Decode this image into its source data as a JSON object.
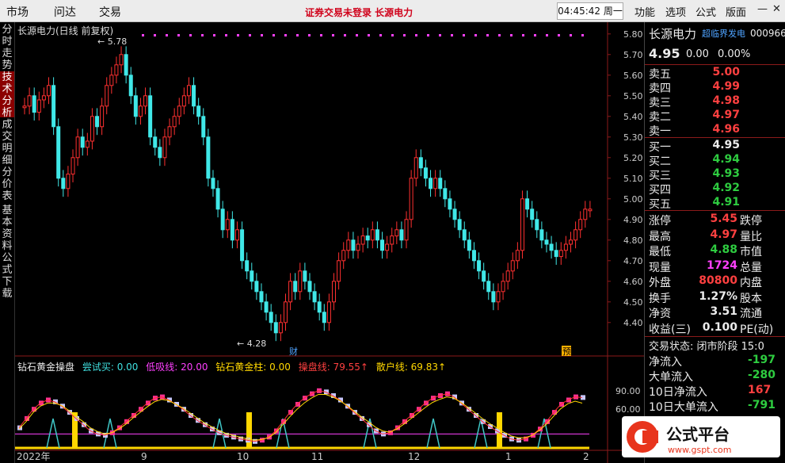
{
  "menu": {
    "items": [
      "市场",
      "问达",
      "交易"
    ]
  },
  "center_notice": "证券交易未登录  长源电力",
  "clock": "04:45:42 周一",
  "right_menu": [
    "功能",
    "选项",
    "公式",
    "版面"
  ],
  "left_tabs": [
    "分时走势",
    "技术分析",
    "成交明细",
    "分价表",
    "基本资料",
    "公式下载"
  ],
  "chart_title": "长源电力(日线 前复权)",
  "indicator": {
    "name": "钻石黄金操盘",
    "fields": [
      {
        "label": "尝试买: 0.00",
        "color": "#40e0e0"
      },
      {
        "label": "低吸线: 20.00",
        "color": "#ff40ff"
      },
      {
        "label": "钻石黄金柱: 0.00",
        "color": "#ffd700"
      },
      {
        "label": "操盘线: 79.55↑",
        "color": "#ff4040"
      },
      {
        "label": "散户线: 69.83↑",
        "color": "#ffd700"
      }
    ]
  },
  "price_axis": [
    "5.80",
    "5.70",
    "5.60",
    "5.50",
    "5.40",
    "5.30",
    "5.20",
    "5.10",
    "5.00",
    "4.90",
    "4.80",
    "4.70",
    "4.60",
    "4.50",
    "4.40"
  ],
  "ind_axis": [
    "90.00",
    "60.00"
  ],
  "date_axis": [
    "2022年",
    "9",
    "10",
    "11",
    "12",
    "1",
    "2"
  ],
  "annotations": {
    "high": "5.78",
    "low": "4.28",
    "cai": "财",
    "yu": "预"
  },
  "quote": {
    "name": "长源电力",
    "concept": "超临界发电",
    "code": "000966",
    "price": "4.95",
    "change": "0.00",
    "pct": "0.00%",
    "asks": [
      {
        "label": "卖五",
        "price": "5.00"
      },
      {
        "label": "卖四",
        "price": "4.99"
      },
      {
        "label": "卖三",
        "price": "4.98"
      },
      {
        "label": "卖二",
        "price": "4.97"
      },
      {
        "label": "卖一",
        "price": "4.96"
      }
    ],
    "bids": [
      {
        "label": "买一",
        "price": "4.95"
      },
      {
        "label": "买二",
        "price": "4.94"
      },
      {
        "label": "买三",
        "price": "4.93"
      },
      {
        "label": "买四",
        "price": "4.92"
      },
      {
        "label": "买五",
        "price": "4.91"
      }
    ],
    "stats": [
      {
        "label": "涨停",
        "value": "5.45",
        "label2": "跌停"
      },
      {
        "label": "最高",
        "value": "4.97",
        "label2": "量比"
      },
      {
        "label": "最低",
        "value": "4.88",
        "label2": "市值"
      },
      {
        "label": "现量",
        "value": "1724",
        "label2": "总量"
      },
      {
        "label": "外盘",
        "value": "80800",
        "label2": "内盘"
      },
      {
        "label": "换手",
        "value": "1.27%",
        "label2": "股本"
      },
      {
        "label": "净资",
        "value": "3.51",
        "label2": "流通"
      },
      {
        "label": "收益(三)",
        "value": "0.100",
        "label2": "PE(动)"
      }
    ],
    "status": "交易状态: 闭市阶段 15:0",
    "flows": [
      {
        "label": "净流入",
        "value": "-197"
      },
      {
        "label": "大单流入",
        "value": "-280"
      },
      {
        "label": "10日净流入",
        "value": "167"
      },
      {
        "label": "10日大单流入",
        "value": "-791"
      }
    ]
  },
  "chart_data": {
    "type": "candlestick",
    "y_range": [
      4.28,
      5.78
    ],
    "closes": [
      5.45,
      5.5,
      5.42,
      5.48,
      5.5,
      5.55,
      5.35,
      5.1,
      5.05,
      5.12,
      5.2,
      5.3,
      5.25,
      5.28,
      5.4,
      5.35,
      5.45,
      5.55,
      5.6,
      5.65,
      5.7,
      5.6,
      5.5,
      5.4,
      5.45,
      5.5,
      5.3,
      5.25,
      5.2,
      5.3,
      5.35,
      5.4,
      5.45,
      5.5,
      5.55,
      5.45,
      5.4,
      5.3,
      5.1,
      5.05,
      4.95,
      4.85,
      4.9,
      4.8,
      4.85,
      4.7,
      4.65,
      4.6,
      4.55,
      4.5,
      4.45,
      4.4,
      4.35,
      4.4,
      4.5,
      4.6,
      4.55,
      4.65,
      4.6,
      4.55,
      4.5,
      4.45,
      4.4,
      4.5,
      4.6,
      4.7,
      4.75,
      4.8,
      4.75,
      4.78,
      4.82,
      4.8,
      4.85,
      4.8,
      4.75,
      4.78,
      4.82,
      4.85,
      4.8,
      4.9,
      5.1,
      5.2,
      5.15,
      5.1,
      5.05,
      5.1,
      5.05,
      5.0,
      4.95,
      4.9,
      4.85,
      4.8,
      4.75,
      4.7,
      4.65,
      4.6,
      4.55,
      4.5,
      4.55,
      4.6,
      4.65,
      4.7,
      4.75,
      5.0,
      4.95,
      4.9,
      4.85,
      4.8,
      4.78,
      4.75,
      4.72,
      4.75,
      4.78,
      4.8,
      4.85,
      4.9,
      4.95,
      4.95
    ],
    "osc_red": [
      30,
      45,
      60,
      70,
      75,
      72,
      65,
      55,
      45,
      35,
      25,
      20,
      18,
      22,
      30,
      40,
      50,
      60,
      70,
      78,
      80,
      75,
      68,
      60,
      50,
      42,
      35,
      28,
      22,
      18,
      15,
      12,
      10,
      8,
      10,
      15,
      25,
      40,
      55,
      68,
      78,
      85,
      90,
      88,
      82,
      75,
      65,
      55,
      45,
      35,
      25,
      20,
      22,
      30,
      40,
      50,
      60,
      70,
      78,
      82,
      85,
      80,
      70,
      60,
      50,
      40,
      32,
      25,
      18,
      12,
      10,
      12,
      18,
      28,
      40,
      55,
      68,
      75,
      80,
      79
    ],
    "osc_yellow": [
      28,
      40,
      55,
      65,
      70,
      70,
      66,
      58,
      48,
      40,
      30,
      24,
      20,
      22,
      28,
      36,
      46,
      55,
      64,
      72,
      76,
      74,
      68,
      62,
      54,
      46,
      38,
      32,
      26,
      21,
      18,
      15,
      12,
      10,
      11,
      14,
      22,
      35,
      48,
      60,
      70,
      78,
      84,
      84,
      80,
      74,
      66,
      57,
      48,
      40,
      31,
      25,
      23,
      28,
      36,
      45,
      54,
      63,
      71,
      76,
      80,
      78,
      71,
      63,
      54,
      45,
      37,
      30,
      23,
      17,
      14,
      14,
      18,
      26,
      36,
      49,
      61,
      69,
      73,
      69.83
    ]
  }
}
